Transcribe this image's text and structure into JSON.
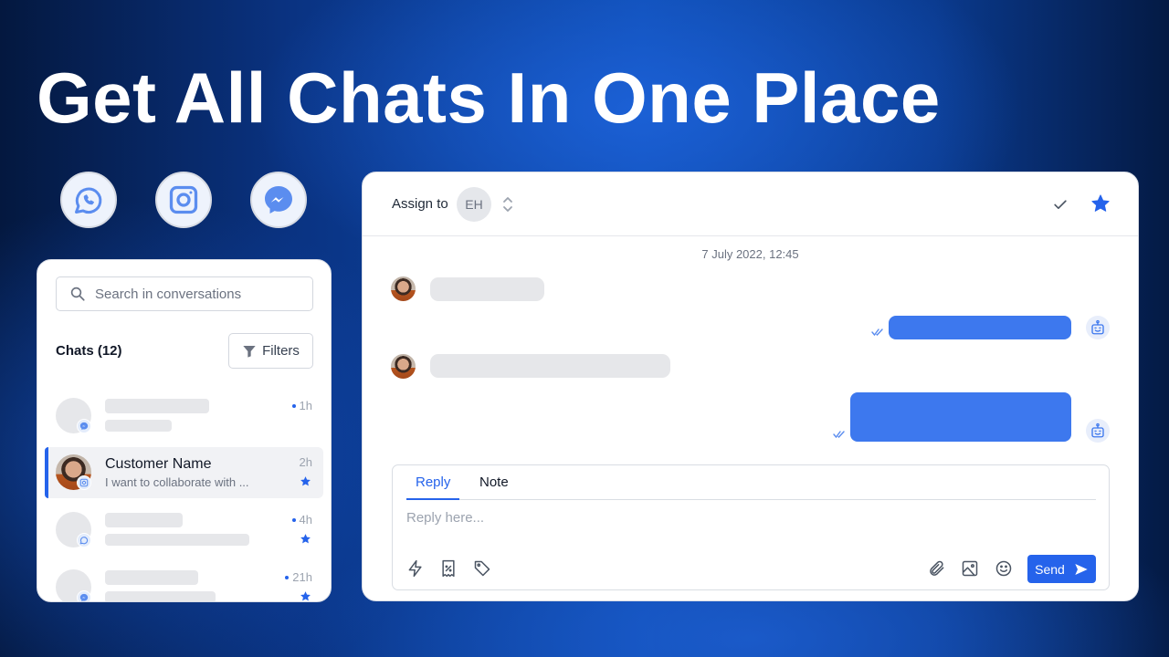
{
  "headline": "Get All Chats In One Place",
  "channels": [
    {
      "name": "whatsapp",
      "icon": "whatsapp-icon"
    },
    {
      "name": "instagram",
      "icon": "instagram-icon"
    },
    {
      "name": "messenger",
      "icon": "messenger-icon"
    }
  ],
  "colors": {
    "accent": "#2563eb",
    "outgoing_bubble": "#3d78ee",
    "skeleton": "#e6e7ea",
    "channel_icon": "#5b8def"
  },
  "inbox": {
    "search_placeholder": "Search in conversations",
    "chats_title": "Chats (12)",
    "filters_label": "Filters",
    "chats": [
      {
        "name": "",
        "preview": "",
        "time": "1h",
        "unread": true,
        "starred": false,
        "channel": "messenger",
        "placeholder": true
      },
      {
        "name": "Customer Name",
        "preview": "I want to collaborate with ...",
        "time": "2h",
        "unread": false,
        "starred": true,
        "channel": "instagram",
        "placeholder": false,
        "active": true
      },
      {
        "name": "",
        "preview": "",
        "time": "4h",
        "unread": true,
        "starred": true,
        "channel": "whatsapp",
        "placeholder": true
      },
      {
        "name": "",
        "preview": "",
        "time": "21h",
        "unread": true,
        "starred": true,
        "channel": "messenger",
        "placeholder": true
      }
    ]
  },
  "conversation": {
    "assign_label": "Assign to",
    "assignee_initials": "EH",
    "date": "7 July 2022, 12:45",
    "messages": [
      {
        "direction": "incoming"
      },
      {
        "direction": "outgoing",
        "status": "read"
      },
      {
        "direction": "incoming"
      },
      {
        "direction": "outgoing",
        "status": "read"
      }
    ],
    "composer": {
      "tabs": [
        "Reply",
        "Note"
      ],
      "active_tab": "Reply",
      "placeholder": "Reply here...",
      "send_label": "Send",
      "tools_left": [
        "lightning-icon",
        "discount-receipt-icon",
        "tag-icon"
      ],
      "tools_right": [
        "paperclip-icon",
        "image-icon",
        "emoji-icon"
      ]
    }
  }
}
